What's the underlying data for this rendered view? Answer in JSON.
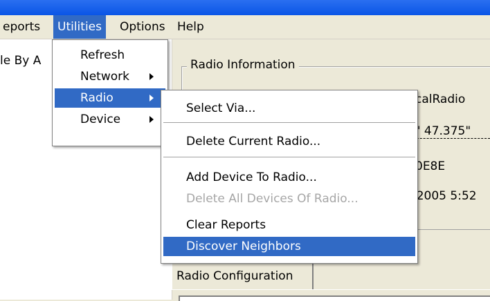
{
  "menubar": {
    "items": [
      "eports",
      "Utilities",
      "Options",
      "Help"
    ]
  },
  "left_pane": {
    "text": "le By A"
  },
  "radio_info": {
    "group_label": "Radio Information",
    "values": [
      "calRadio",
      "3' 47.375\" ",
      "0E8E",
      "/2005 5:52"
    ]
  },
  "tab": {
    "label": "Radio Configuration"
  },
  "utilities_menu": {
    "items": [
      "Refresh",
      "Network",
      "Radio",
      "Device"
    ]
  },
  "radio_submenu": {
    "select_via": "Select Via...",
    "delete_current": "Delete Current Radio...",
    "add_device": "Add Device To Radio...",
    "delete_all": "Delete All Devices Of Radio...",
    "clear_reports": "Clear Reports",
    "discover_neighbors": "Discover Neighbors"
  },
  "colors": {
    "highlight": "#316ac5",
    "titlebar": "#0a55e6",
    "face": "#ece9d8"
  }
}
